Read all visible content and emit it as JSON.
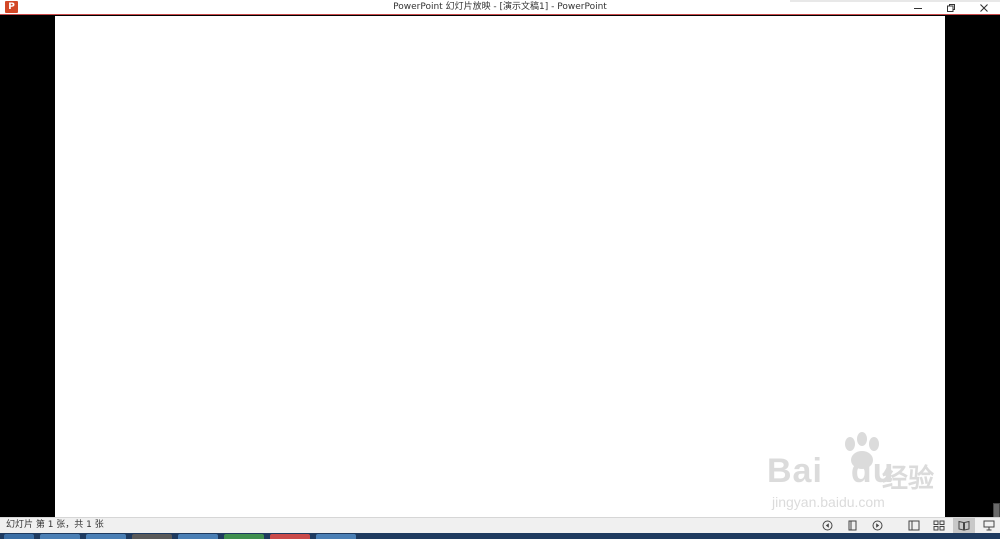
{
  "window": {
    "title": "PowerPoint 幻灯片放映 - [演示文稿1] - PowerPoint",
    "app_icon": "powerpoint-icon",
    "app_icon_letter": "P",
    "controls": [
      "minimize-icon",
      "restore-icon",
      "close-icon"
    ]
  },
  "watermark": {
    "main": "Bai",
    "paw": "paw-icon",
    "main2": "du",
    "cn": "经验",
    "sub": "jingyan.baidu.com"
  },
  "status": {
    "slide_info": "幻灯片 第 1 张，共 1 张"
  },
  "colors": {
    "accent": "#c94a4a",
    "powerpoint": "#d24726",
    "slide_bg": "#ffffff",
    "stage_bg": "#000000",
    "status_bg": "#f0f0f0"
  }
}
